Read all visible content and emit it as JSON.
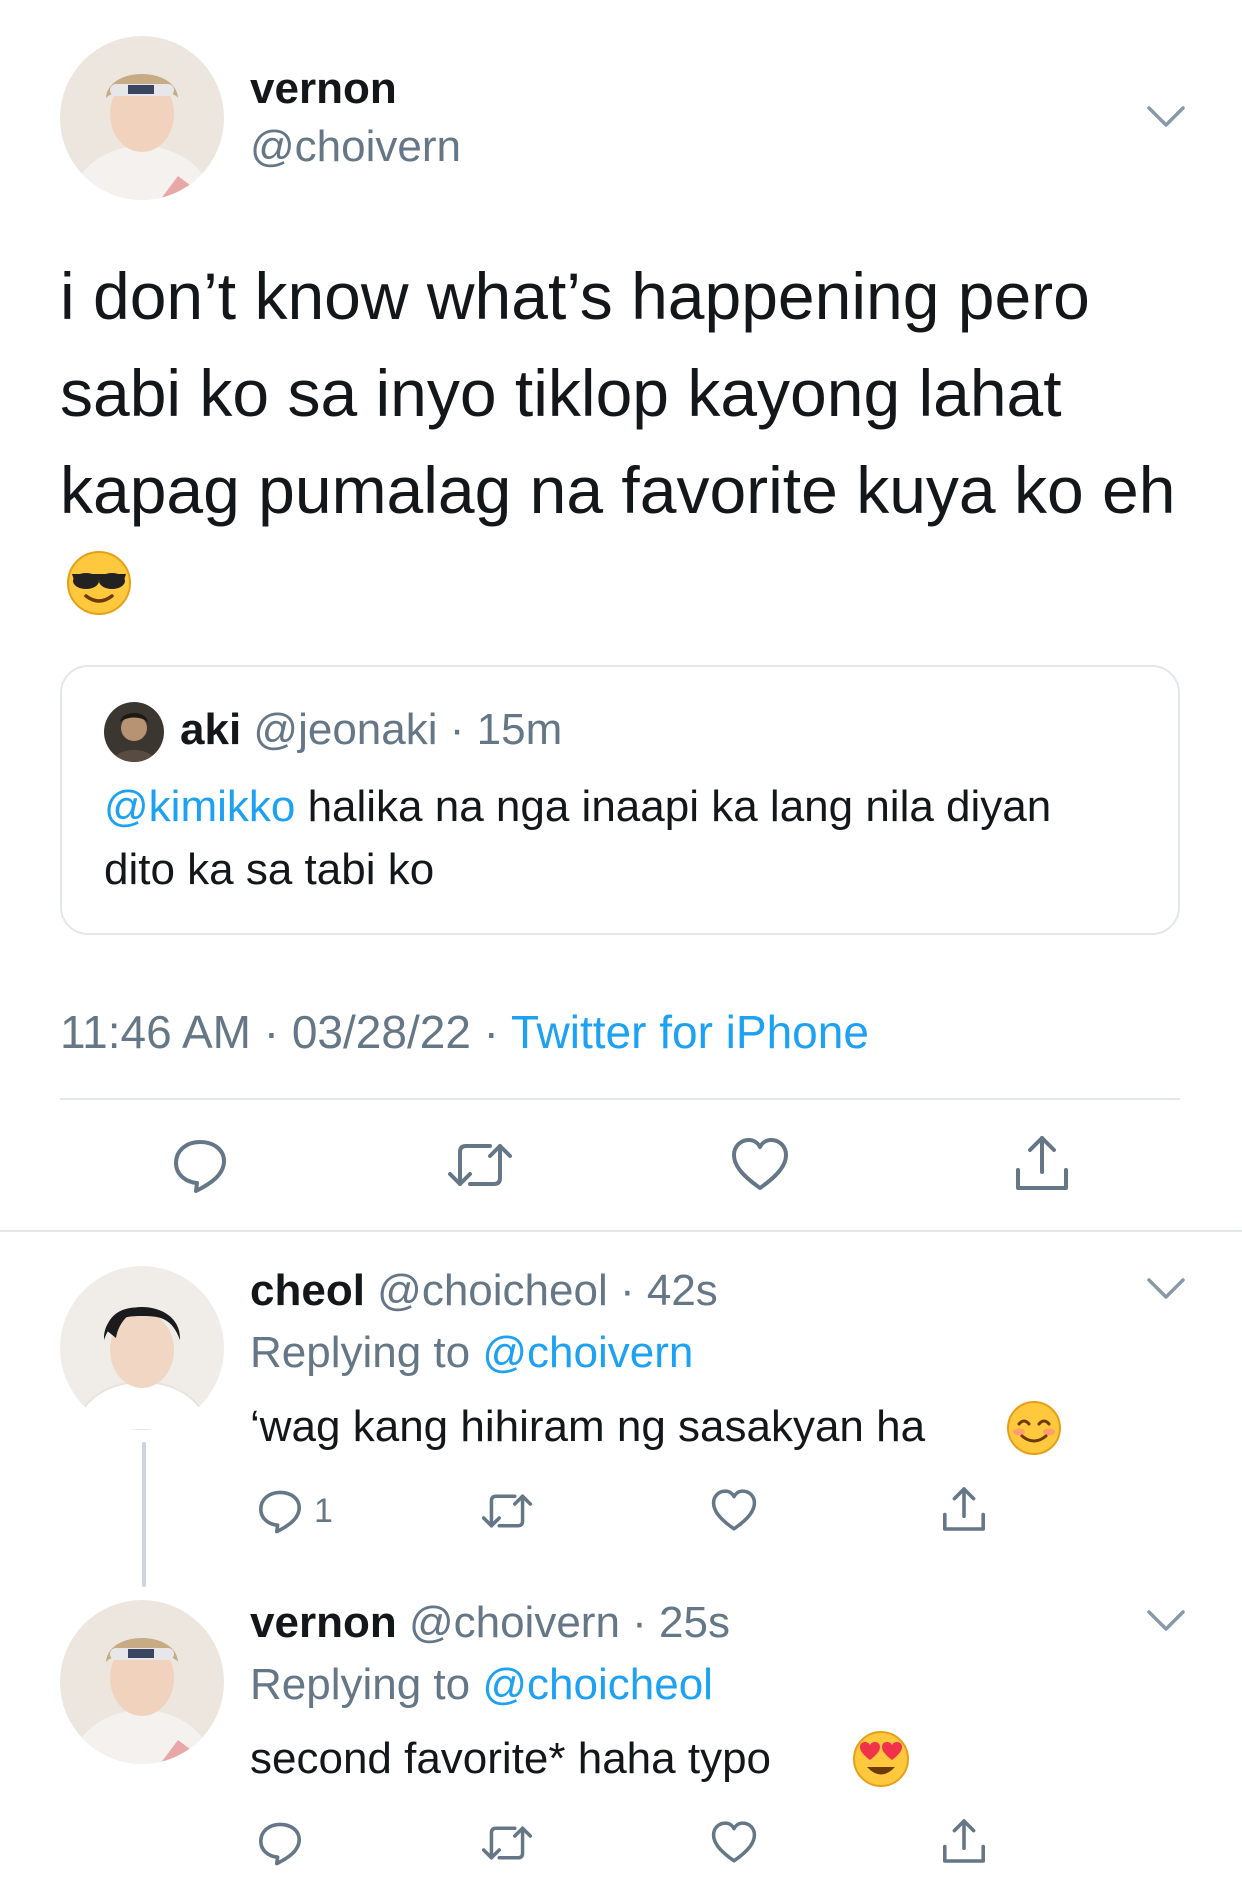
{
  "colors": {
    "link": "#1da1f2",
    "muted": "#657786",
    "divider": "#e1e8ed",
    "text": "#14171a"
  },
  "main_tweet": {
    "name": "vernon",
    "handle": "@choivern",
    "avatar_icon": "avatar-photo-vernon",
    "text_lines": [
      "i don’t know what’s happening pero",
      "sabi ko sa inyo tiklop kayong lahat",
      "kapag pumalag na favorite kuya ko eh"
    ],
    "emoji": "smiling-face-with-sunglasses",
    "quote": {
      "name": "aki",
      "handle": "@jeonaki",
      "time": "15m",
      "mention": "@kimikko",
      "text_rest": " halika na nga inaapi ka lang nila diyan",
      "text_line2": "dito ka sa tabi ko"
    },
    "time": "11:46 AM",
    "date": "03/28/22",
    "source": "Twitter for iPhone",
    "actions": [
      "reply-icon",
      "retweet-icon",
      "like-icon",
      "share-icon"
    ]
  },
  "replies": [
    {
      "name": "cheol",
      "handle": "@choicheol",
      "time": "42s",
      "replying_label": "Replying to",
      "replying_to": "@choivern",
      "text": "‘wag kang hihiram ng sasakyan ha",
      "emoji": "smiling-face",
      "reply_count": "1"
    },
    {
      "name": "vernon",
      "handle": "@choivern",
      "time": "25s",
      "replying_label": "Replying to",
      "replying_to": "@choicheol",
      "text": "second favorite* haha typo",
      "emoji": "heart-eyes-face",
      "reply_count": ""
    }
  ],
  "separator": " · "
}
